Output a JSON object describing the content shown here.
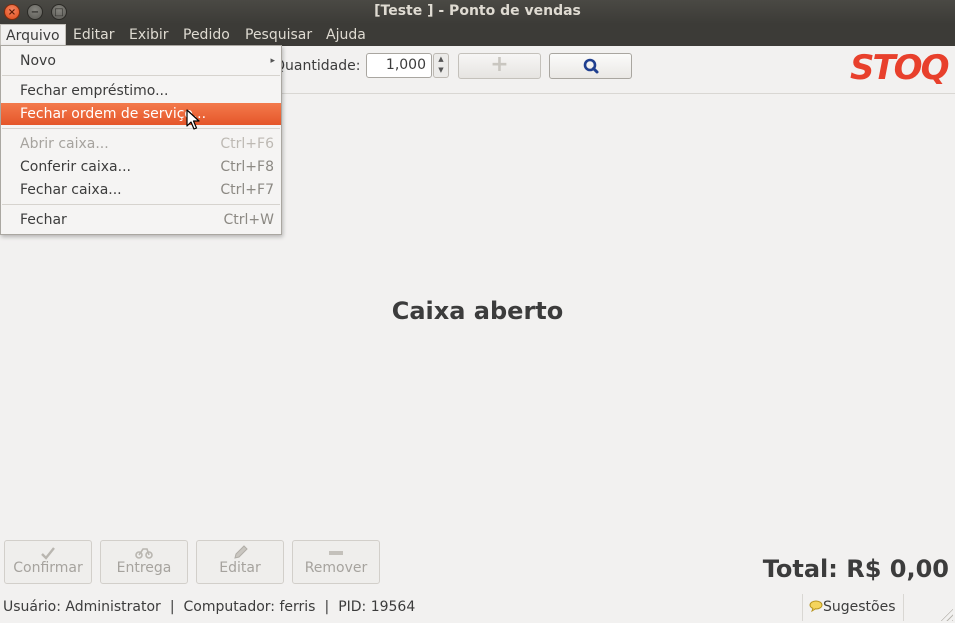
{
  "window": {
    "title": "[Teste ] - Ponto de vendas",
    "close_glyph": "×",
    "min_glyph": "−",
    "max_glyph": "□"
  },
  "menubar": {
    "items": [
      "Arquivo",
      "Editar",
      "Exibir",
      "Pedido",
      "Pesquisar",
      "Ajuda"
    ]
  },
  "file_menu": {
    "novo": "Novo",
    "fechar_emprestimo": "Fechar empréstimo...",
    "fechar_ordem": "Fechar ordem de serviço...",
    "abrir_caixa": "Abrir caixa...",
    "abrir_caixa_accel": "Ctrl+F6",
    "conferir_caixa": "Conferir caixa...",
    "conferir_caixa_accel": "Ctrl+F8",
    "fechar_caixa": "Fechar caixa...",
    "fechar_caixa_accel": "Ctrl+F7",
    "fechar": "Fechar",
    "fechar_accel": "Ctrl+W"
  },
  "toolbar": {
    "quantity_label": "Quantidade:",
    "quantity_value": "1,000",
    "add_glyph": "+"
  },
  "logo_text": "STOQ",
  "logo_color": "#e8402c",
  "accent_color": "#e5562a",
  "main": {
    "status_message": "Caixa aberto"
  },
  "bottom_buttons": {
    "confirmar": "Confirmar",
    "entrega": "Entrega",
    "editar": "Editar",
    "remover": "Remover"
  },
  "total": "Total: R$ 0,00",
  "statusbar": {
    "user": "Usuário: Administrator",
    "sep": "|",
    "computer": "Computador: ferris",
    "pid": "PID: 19564",
    "suggestions": "Sugestões"
  }
}
